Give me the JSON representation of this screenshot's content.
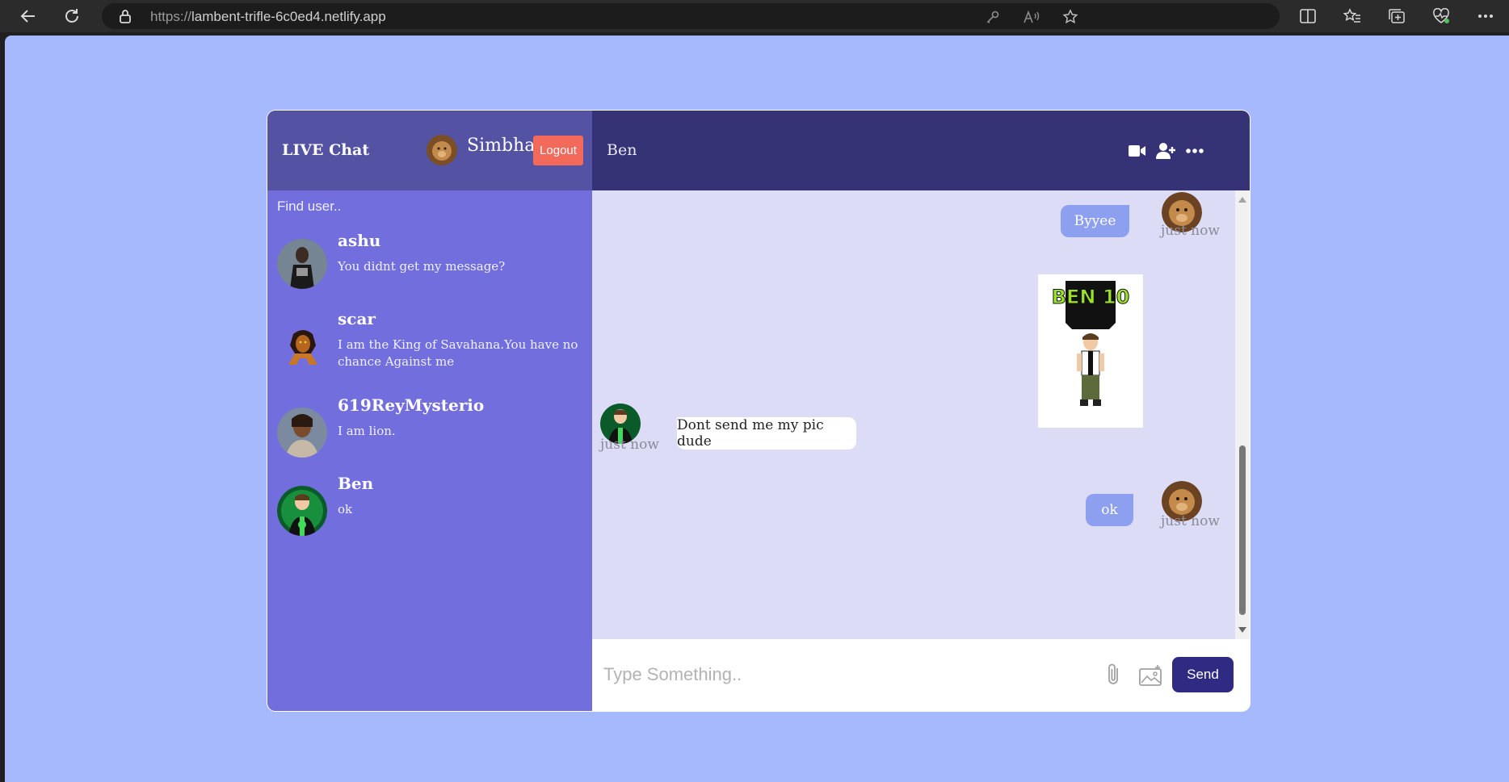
{
  "browser": {
    "url_protocol": "https://",
    "url_host": "lambent-trifle-6c0ed4.netlify.app"
  },
  "sidebar": {
    "brand": "LIVE Chat",
    "current_user": "Simbha",
    "logout_label": "Logout",
    "search_placeholder": "Find user..",
    "contacts": [
      {
        "name": "ashu",
        "last_message": "You didnt get my message?"
      },
      {
        "name": "scar",
        "last_message": "I am the King of Savahana.You have no chance Against me"
      },
      {
        "name": "619ReyMysterio",
        "last_message": "I am lion."
      },
      {
        "name": "Ben",
        "last_message": "ok"
      }
    ]
  },
  "chat": {
    "title": "Ben",
    "header_icons": [
      "video-camera-icon",
      "add-user-icon",
      "more-options-icon"
    ],
    "messages": [
      {
        "from": "owner",
        "text": "Byyee",
        "time": "just now"
      },
      {
        "from": "owner",
        "type": "image",
        "image_text": "BEN 10",
        "time": ""
      },
      {
        "from": "other",
        "text": "Dont send me my pic dude",
        "time": "just now"
      },
      {
        "from": "owner",
        "text": "ok",
        "time": "just now"
      }
    ],
    "composer": {
      "placeholder": "Type Something..",
      "send_label": "Send"
    }
  },
  "colors": {
    "page_bg": "#a7b9fd",
    "sidebar_bg": "#736ede",
    "sidebar_header_bg": "#5452a3",
    "chat_header_bg": "#353276",
    "messages_bg": "#dddcf7",
    "owner_bubble": "#8da0f0",
    "logout_bg": "#f46a5a",
    "send_bg": "#2f2b83"
  }
}
